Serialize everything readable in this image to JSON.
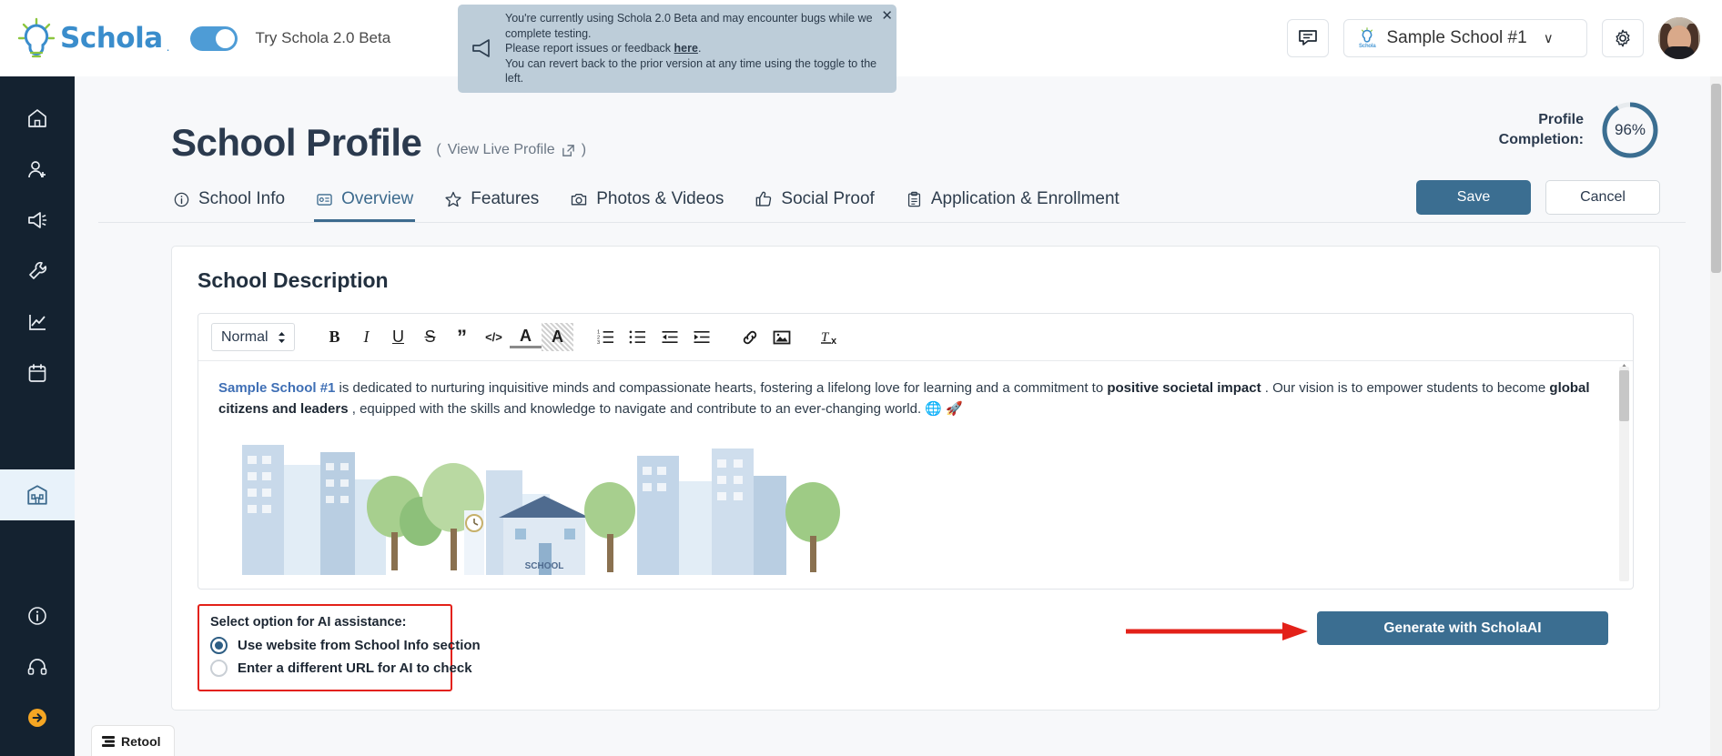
{
  "brand": {
    "name": "Schola",
    "trademark": ".",
    "toggle_label": "Try Schola 2.0 Beta"
  },
  "banner": {
    "line1": "You're currently using Schola 2.0 Beta and may encounter bugs while we complete testing.",
    "line2_pre": "Please report issues or feedback ",
    "line2_link": "here",
    "line2_post": ".",
    "line3": "You can revert back to the prior version at any time using the toggle to the left.",
    "close_label": "✕"
  },
  "topbar": {
    "chat_icon": "chat-bubble-icon",
    "school_selector": "Sample School #1",
    "school_selector_caret": "∨",
    "settings_icon": "gear-icon",
    "avatar": "user-avatar"
  },
  "sidebar": {
    "items": [
      {
        "name": "home",
        "icon": "home-icon"
      },
      {
        "name": "leads",
        "icon": "user-plus-icon"
      },
      {
        "name": "campaigns",
        "icon": "megaphone-icon"
      },
      {
        "name": "tools",
        "icon": "wrench-icon"
      },
      {
        "name": "analytics",
        "icon": "chart-line-icon"
      },
      {
        "name": "calendar",
        "icon": "calendar-icon"
      },
      {
        "name": "school-profile",
        "icon": "school-building-icon",
        "active": true
      }
    ],
    "bottom_items": [
      {
        "name": "info",
        "icon": "info-circle-icon"
      },
      {
        "name": "support",
        "icon": "headset-icon"
      },
      {
        "name": "expand",
        "icon": "arrow-right-circle-icon"
      }
    ]
  },
  "page": {
    "title": "School Profile",
    "live_profile_open": "(",
    "live_profile_label": "View Live Profile",
    "live_profile_close": ")",
    "completion_label_l1": "Profile",
    "completion_label_l2": "Completion:",
    "completion_value": "96%",
    "completion_percent": 96,
    "accent_color": "#3b6e91"
  },
  "tabs": [
    {
      "label": "School Info",
      "icon": "info-circle-icon",
      "active": false
    },
    {
      "label": "Overview",
      "icon": "id-card-icon",
      "active": true
    },
    {
      "label": "Features",
      "icon": "star-icon",
      "active": false
    },
    {
      "label": "Photos & Videos",
      "icon": "camera-icon",
      "active": false
    },
    {
      "label": "Social Proof",
      "icon": "thumbs-up-icon",
      "active": false
    },
    {
      "label": "Application & Enrollment",
      "icon": "clipboard-icon",
      "active": false
    }
  ],
  "actions": {
    "save": "Save",
    "cancel": "Cancel"
  },
  "card": {
    "title": "School Description",
    "toolbar": {
      "style_select": "Normal",
      "buttons": [
        {
          "name": "bold",
          "glyph": "B"
        },
        {
          "name": "italic",
          "glyph": "I"
        },
        {
          "name": "underline",
          "glyph": "U"
        },
        {
          "name": "strikethrough",
          "glyph": "S"
        },
        {
          "name": "blockquote",
          "glyph": "”"
        },
        {
          "name": "code-block",
          "glyph": "</>"
        },
        {
          "name": "text-color",
          "glyph": "A"
        },
        {
          "name": "background-color",
          "glyph": "A"
        },
        {
          "name": "ordered-list",
          "glyph": "1."
        },
        {
          "name": "bullet-list",
          "glyph": "•"
        },
        {
          "name": "outdent",
          "glyph": "←"
        },
        {
          "name": "indent",
          "glyph": "→"
        },
        {
          "name": "link",
          "glyph": "⛓"
        },
        {
          "name": "image",
          "glyph": "▣"
        },
        {
          "name": "clear-formatting",
          "glyph": "Tx"
        }
      ]
    },
    "description": {
      "school_name": "Sample School #1",
      "part1": " is dedicated to nurturing inquisitive minds and compassionate hearts, fostering a lifelong love for learning and a commitment to  ",
      "bold1": "positive societal impact",
      "part2": " . Our vision is to empower students to become ",
      "bold2": "global citizens and leaders",
      "part3": " , equipped with the skills and knowledge to navigate and contribute to an ever-changing world. ",
      "emoji": "🌐 🚀"
    },
    "illustration_label": "SCHOOL"
  },
  "ai": {
    "title": "Select option for AI assistance:",
    "options": [
      {
        "label": "Use website from School Info section",
        "selected": true
      },
      {
        "label": "Enter a different URL for AI to check",
        "selected": false
      }
    ],
    "generate_button": "Generate with ScholaAI",
    "highlight_color": "#e32119"
  },
  "footer": {
    "retool_label": "Retool"
  }
}
